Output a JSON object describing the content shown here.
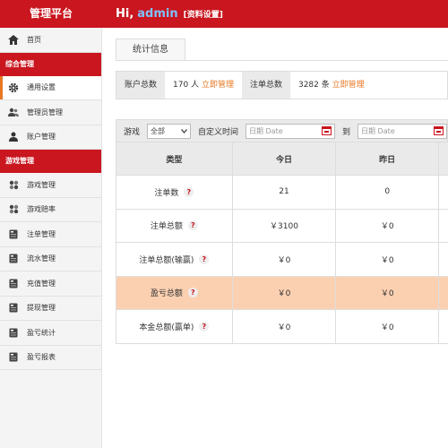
{
  "header": {
    "brand": "管理平台",
    "greeting": "Hi,",
    "username": "admin",
    "settings_link": "[资料设置]"
  },
  "sidebar": {
    "home": {
      "label": "首页",
      "icon": "home-icon"
    },
    "group1": "综合管理",
    "general_settings": {
      "label": "通用设置",
      "icon": "gear-icon"
    },
    "admin_mgmt": {
      "label": "管理员管理",
      "icon": "users-icon"
    },
    "account_mgmt": {
      "label": "账户管理",
      "icon": "user-icon"
    },
    "group2": "游戏管理",
    "game_items": [
      {
        "label": "游戏管理",
        "icon": "grid-icon"
      },
      {
        "label": "游戏赔率",
        "icon": "grid-icon"
      },
      {
        "label": "注单管理",
        "icon": "doc-icon"
      },
      {
        "label": "流水管理",
        "icon": "doc-icon"
      },
      {
        "label": "充值管理",
        "icon": "doc-icon"
      },
      {
        "label": "提现管理",
        "icon": "doc-icon"
      },
      {
        "label": "盈亏统计",
        "icon": "doc-icon"
      },
      {
        "label": "盈亏报表",
        "icon": "doc-icon"
      }
    ]
  },
  "main": {
    "tab": "统计信息",
    "stats": {
      "accounts_label": "账户总数",
      "accounts_value": "170 人",
      "accounts_link": "立即管理",
      "orders_label": "注单总数",
      "orders_value": "3282 条",
      "orders_link": "立即管理"
    },
    "filter": {
      "game_label": "游戏",
      "game_value": "全部",
      "custom_time_label": "自定义时间",
      "date_placeholder": "日期 Date",
      "to_label": "到"
    },
    "table": {
      "headers": [
        "类型",
        "今日",
        "昨日"
      ],
      "rows": [
        {
          "type": "注单数",
          "today": "21",
          "yesterday": "0"
        },
        {
          "type": "注单总额",
          "today": "￥3100",
          "yesterday": "￥0"
        },
        {
          "type": "注单总额(输赢)",
          "today": "￥0",
          "yesterday": "￥0"
        },
        {
          "type": "盈亏总额",
          "today": "￥0",
          "yesterday": "￥0"
        },
        {
          "type": "本金总额(赢单)",
          "today": "￥0",
          "yesterday": "￥0"
        }
      ]
    }
  },
  "colors": {
    "brand_red": "#c9161f",
    "accent_orange": "#e87722",
    "highlight_row": "#fbd0b1"
  }
}
